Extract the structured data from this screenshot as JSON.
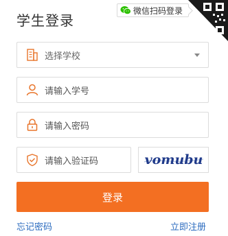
{
  "title": "学生登录",
  "wechat_login": {
    "label": "微信扫码登录",
    "icon": "wechat-icon"
  },
  "qr_corner": {
    "icon": "qr-code-icon"
  },
  "form": {
    "school": {
      "value": "选择学校",
      "icon": "building-icon",
      "dropdown_icon": "caret-down-icon"
    },
    "student_id": {
      "placeholder": "请输入学号",
      "icon": "user-icon"
    },
    "password": {
      "placeholder": "请输入密码",
      "icon": "lock-icon"
    },
    "captcha": {
      "placeholder": "请输入验证码",
      "icon": "shield-check-icon",
      "image_text": "vomubu"
    }
  },
  "login_button": {
    "label": "登录"
  },
  "links": {
    "forgot_password": "忘记密码",
    "register": "立即注册"
  },
  "colors": {
    "accent": "#f36f22",
    "link": "#2b6bbf",
    "icon": "#e8742a",
    "wechat": "#2dc100",
    "captcha_text": "#1f3a8a"
  }
}
